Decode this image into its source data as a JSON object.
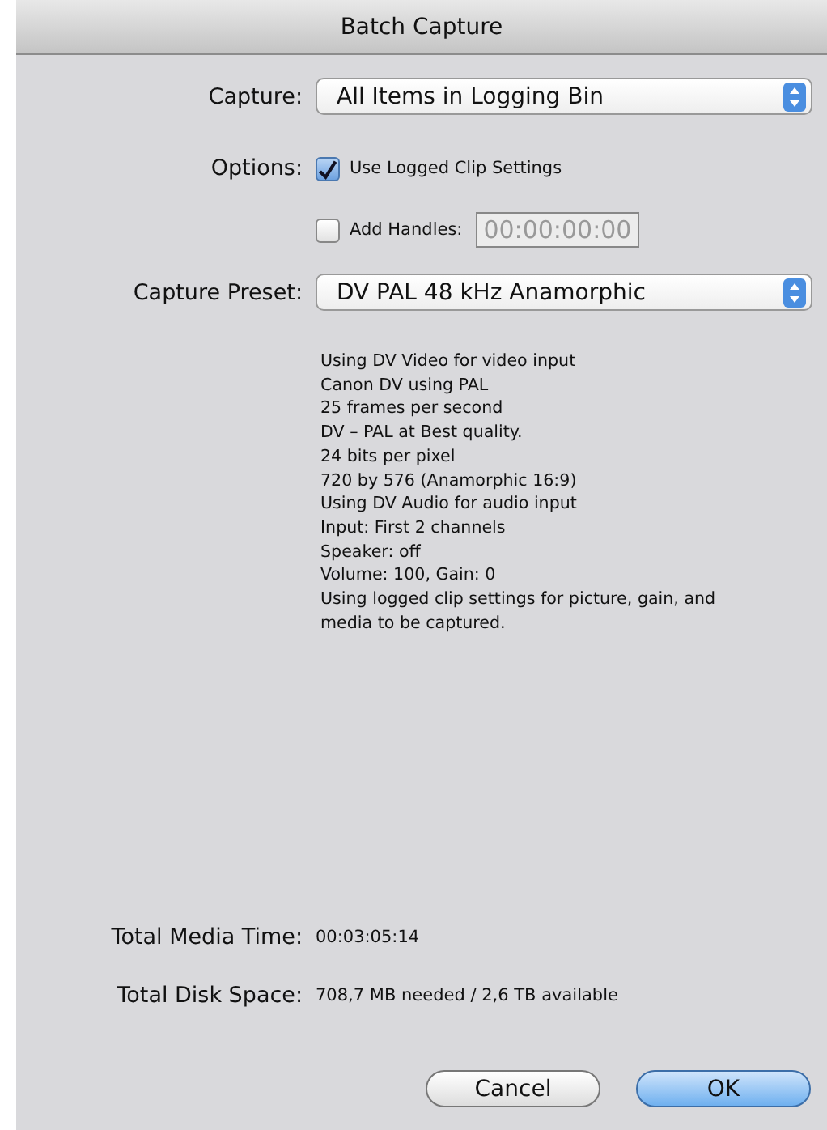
{
  "window": {
    "title": "Batch Capture"
  },
  "capture": {
    "label": "Capture:",
    "value": "All Items in Logging Bin"
  },
  "options": {
    "label": "Options:",
    "items": [
      {
        "label": "Use Logged Clip Settings",
        "checked": true
      },
      {
        "label": "Add Handles:",
        "checked": false,
        "field_value": "00:00:00:00",
        "disabled": true
      }
    ]
  },
  "preset": {
    "label": "Capture Preset:",
    "value": "DV PAL 48 kHz Anamorphic"
  },
  "description": [
    "Using DV Video for video input",
    "Canon DV using PAL",
    "25 frames per second",
    "DV – PAL at Best quality.",
    "24 bits per pixel",
    "720 by 576 (Anamorphic 16:9)",
    "Using DV Audio for audio input",
    "Input: First 2 channels",
    "Speaker: off",
    "Volume: 100, Gain: 0",
    "Using logged clip settings for picture, gain, and",
    "media to be captured."
  ],
  "totals": [
    {
      "label": "Total Media Time:",
      "value": "00:03:05:14"
    },
    {
      "label": "Total Disk Space:",
      "value": "708,7 MB needed / 2,6 TB available"
    }
  ],
  "buttons": [
    {
      "label": "Cancel",
      "default": false
    },
    {
      "label": "OK",
      "default": true
    }
  ]
}
